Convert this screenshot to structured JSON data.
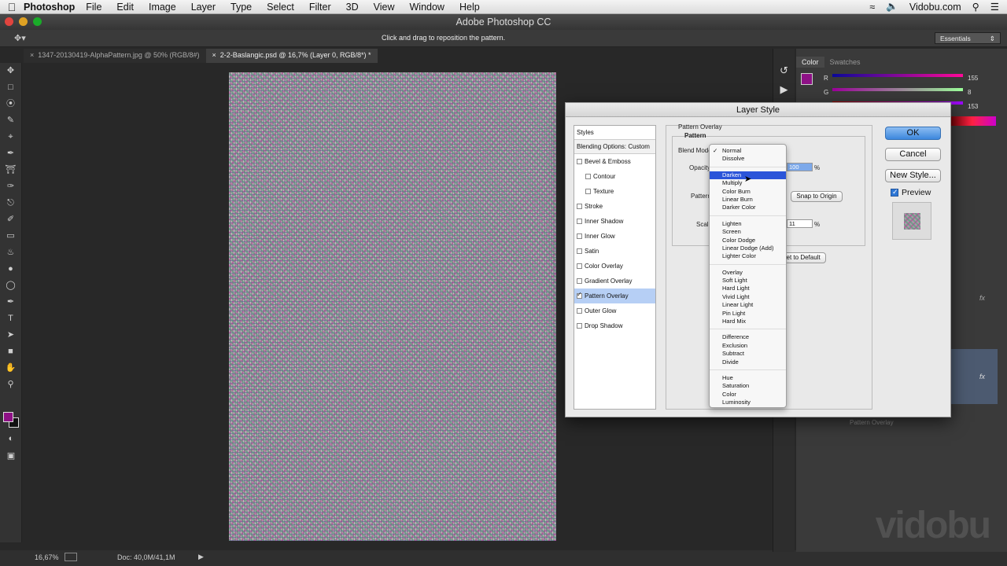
{
  "menubar": {
    "app": "Photoshop",
    "items": [
      "File",
      "Edit",
      "Image",
      "Layer",
      "Type",
      "Select",
      "Filter",
      "3D",
      "View",
      "Window",
      "Help"
    ],
    "right_label": "Vidobu.com"
  },
  "window": {
    "title": "Adobe Photoshop CC"
  },
  "options": {
    "hint": "Click and drag to reposition the pattern.",
    "workspace": "Essentials"
  },
  "tabs": [
    {
      "label": "1347-20130419-AlphaPattern.jpg @ 50% (RGB/8#)"
    },
    {
      "label": "2-2-Baslangic.psd @ 16,7% (Layer 0, RGB/8*) *"
    }
  ],
  "status": {
    "zoom": "16,67%",
    "doc": "Doc: 40,0M/41,1M"
  },
  "color_panel": {
    "tabs": [
      "Color",
      "Swatches"
    ],
    "channels": [
      {
        "label": "R",
        "value": "155"
      },
      {
        "label": "G",
        "value": "8"
      },
      {
        "label": "B",
        "value": "153"
      }
    ],
    "fg_color": "#8e1186"
  },
  "layers": {
    "effect_label": "Pattern Overlay",
    "fx": "fx"
  },
  "dialog": {
    "title": "Layer Style",
    "styles_header": "Styles",
    "blending": "Blending Options: Custom",
    "styles": [
      {
        "label": "Bevel & Emboss",
        "checked": false,
        "indent": false
      },
      {
        "label": "Contour",
        "checked": false,
        "indent": true
      },
      {
        "label": "Texture",
        "checked": false,
        "indent": true
      },
      {
        "label": "Stroke",
        "checked": false,
        "indent": false
      },
      {
        "label": "Inner Shadow",
        "checked": false,
        "indent": false
      },
      {
        "label": "Inner Glow",
        "checked": false,
        "indent": false
      },
      {
        "label": "Satin",
        "checked": false,
        "indent": false
      },
      {
        "label": "Color Overlay",
        "checked": false,
        "indent": false
      },
      {
        "label": "Gradient Overlay",
        "checked": false,
        "indent": false
      },
      {
        "label": "Pattern Overlay",
        "checked": true,
        "indent": false
      },
      {
        "label": "Outer Glow",
        "checked": false,
        "indent": false
      },
      {
        "label": "Drop Shadow",
        "checked": false,
        "indent": false
      }
    ],
    "section_title": "Pattern Overlay",
    "group_title": "Pattern",
    "blend_mode_label": "Blend Mode:",
    "opacity_label": "Opacity",
    "opacity_value": "100",
    "percent": "%",
    "pattern_label": "Pattern",
    "snap_button": "Snap to Origin",
    "scale_label": "Scale",
    "scale_value": "11",
    "reset_button": "Reset to Default",
    "ok": "OK",
    "cancel": "Cancel",
    "new_style": "New Style...",
    "preview": "Preview",
    "preview_checked": true
  },
  "blend_menu": {
    "groups": [
      [
        "Normal",
        "Dissolve"
      ],
      [
        "Darken",
        "Multiply",
        "Color Burn",
        "Linear Burn",
        "Darker Color"
      ],
      [
        "Lighten",
        "Screen",
        "Color Dodge",
        "Linear Dodge (Add)",
        "Lighter Color"
      ],
      [
        "Overlay",
        "Soft Light",
        "Hard Light",
        "Vivid Light",
        "Linear Light",
        "Pin Light",
        "Hard Mix"
      ],
      [
        "Difference",
        "Exclusion",
        "Subtract",
        "Divide"
      ],
      [
        "Hue",
        "Saturation",
        "Color",
        "Luminosity"
      ]
    ],
    "checked": "Normal",
    "highlighted": "Darken"
  },
  "watermark": "vidobu"
}
